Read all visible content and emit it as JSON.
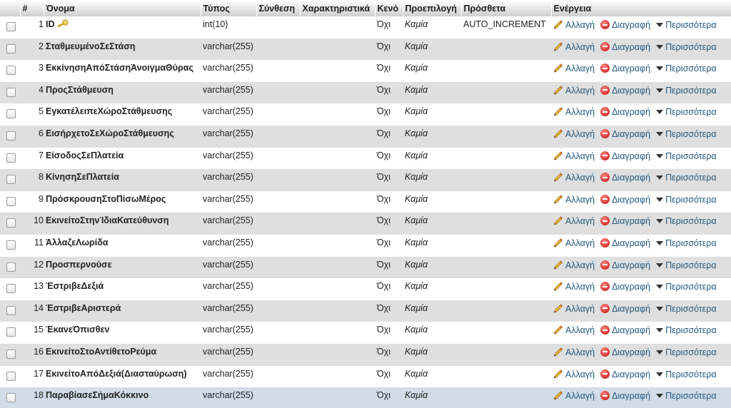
{
  "headers": {
    "num": "#",
    "name": "Όνομα",
    "type": "Τύπος",
    "collation": "Σύνθεση",
    "attributes": "Χαρακτηριστικά",
    "null": "Κενό",
    "default": "Προεπιλογή",
    "extra": "Πρόσθετα",
    "actions": "Ενέργεια"
  },
  "actions": {
    "change": "Αλλαγή",
    "drop": "Διαγραφή",
    "more": "Περισσότερα"
  },
  "colors": {
    "link": "#235a81",
    "row_alt": "#dfdfdf",
    "row_selected": "#d1dce8"
  },
  "rows": [
    {
      "num": "1",
      "name": "ID",
      "type": "int(10)",
      "null": "Όχι",
      "default": "Καμία",
      "extra": "AUTO_INCREMENT",
      "primary_key": true
    },
    {
      "num": "2",
      "name": "ΣταθμευμένοΣεΣτάση",
      "type": "varchar(255)",
      "null": "Όχι",
      "default": "Καμία",
      "extra": ""
    },
    {
      "num": "3",
      "name": "ΕκκίνησηΑπόΣτάσηΆνοιγμαΘύρας",
      "type": "varchar(255)",
      "null": "Όχι",
      "default": "Καμία",
      "extra": ""
    },
    {
      "num": "4",
      "name": "ΠροςΣτάθμευση",
      "type": "varchar(255)",
      "null": "Όχι",
      "default": "Καμία",
      "extra": ""
    },
    {
      "num": "5",
      "name": "ΕγκατέλειπεΧώροΣτάθμευσης",
      "type": "varchar(255)",
      "null": "Όχι",
      "default": "Καμία",
      "extra": ""
    },
    {
      "num": "6",
      "name": "ΕισήρχετοΣεΧώροΣτάθμευσης",
      "type": "varchar(255)",
      "null": "Όχι",
      "default": "Καμία",
      "extra": ""
    },
    {
      "num": "7",
      "name": "ΕίσοδοςΣεΠλατεία",
      "type": "varchar(255)",
      "null": "Όχι",
      "default": "Καμία",
      "extra": ""
    },
    {
      "num": "8",
      "name": "ΚίνησηΣεΠλατεία",
      "type": "varchar(255)",
      "null": "Όχι",
      "default": "Καμία",
      "extra": ""
    },
    {
      "num": "9",
      "name": "ΠρόσκρουσηΣτοΠίσωΜέρος",
      "type": "varchar(255)",
      "null": "Όχι",
      "default": "Καμία",
      "extra": ""
    },
    {
      "num": "10",
      "name": "ΕκινείτοΣτηνΊδιαΚατεύθυνση",
      "type": "varchar(255)",
      "null": "Όχι",
      "default": "Καμία",
      "extra": ""
    },
    {
      "num": "11",
      "name": "ΆλλαζεΛωρίδα",
      "type": "varchar(255)",
      "null": "Όχι",
      "default": "Καμία",
      "extra": ""
    },
    {
      "num": "12",
      "name": "Προσπερνούσε",
      "type": "varchar(255)",
      "null": "Όχι",
      "default": "Καμία",
      "extra": ""
    },
    {
      "num": "13",
      "name": "ΈστριβεΔεξιά",
      "type": "varchar(255)",
      "null": "Όχι",
      "default": "Καμία",
      "extra": ""
    },
    {
      "num": "14",
      "name": "ΈστριβεΑριστερά",
      "type": "varchar(255)",
      "null": "Όχι",
      "default": "Καμία",
      "extra": ""
    },
    {
      "num": "15",
      "name": "ΈκανεΌπισθεν",
      "type": "varchar(255)",
      "null": "Όχι",
      "default": "Καμία",
      "extra": ""
    },
    {
      "num": "16",
      "name": "ΕκινείτοΣτοΑντίθετοΡεύμα",
      "type": "varchar(255)",
      "null": "Όχι",
      "default": "Καμία",
      "extra": ""
    },
    {
      "num": "17",
      "name": "ΕκινείτοΑπόΔεξιά(Διασταύρωση)",
      "type": "varchar(255)",
      "null": "Όχι",
      "default": "Καμία",
      "extra": ""
    },
    {
      "num": "18",
      "name": "ΠαραβίασεΣήμαΚόκκινο",
      "type": "varchar(255)",
      "null": "Όχι",
      "default": "Καμία",
      "extra": "",
      "selected": true
    }
  ]
}
